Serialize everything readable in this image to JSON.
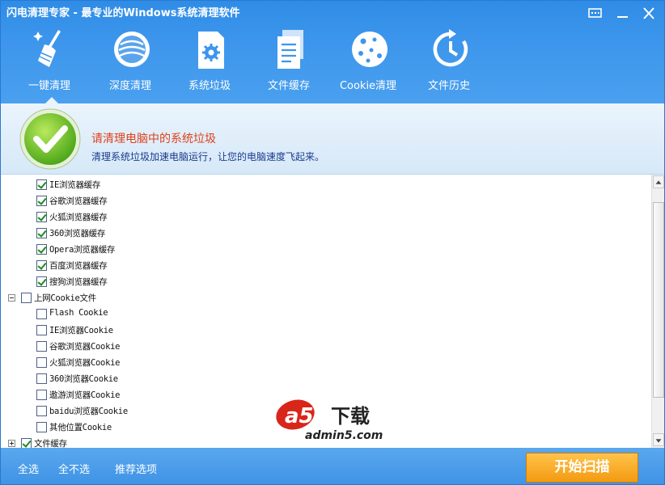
{
  "app": {
    "title": "闪电清理专家 - 最专业的Windows系统清理软件"
  },
  "window_controls": [
    {
      "name": "feedback-icon"
    },
    {
      "name": "minimize-icon"
    },
    {
      "name": "close-icon"
    }
  ],
  "toolbar": {
    "items": [
      {
        "label": "一键清理",
        "icon": "broom-icon",
        "active": true
      },
      {
        "label": "深度清理",
        "icon": "disk-icon",
        "active": false
      },
      {
        "label": "系统垃圾",
        "icon": "gear-document-icon",
        "active": false
      },
      {
        "label": "文件缓存",
        "icon": "file-stack-icon",
        "active": false
      },
      {
        "label": "Cookie清理",
        "icon": "cookie-icon",
        "active": false
      },
      {
        "label": "文件历史",
        "icon": "history-clock-icon",
        "active": false
      }
    ]
  },
  "banner": {
    "title": "请清理电脑中的系统垃圾",
    "subtitle": "清理系统垃圾加速电脑运行，让您的电脑速度飞起来。",
    "title_color": "#e0411b",
    "subtitle_color": "#1a3c8c"
  },
  "tree": {
    "rows": [
      {
        "label": "IE浏览器缓存",
        "checked": true,
        "level": 1
      },
      {
        "label": "谷歌浏览器缓存",
        "checked": true,
        "level": 1
      },
      {
        "label": "火狐浏览器缓存",
        "checked": true,
        "level": 1
      },
      {
        "label": "360浏览器缓存",
        "checked": true,
        "level": 1
      },
      {
        "label": "Opera浏览器缓存",
        "checked": true,
        "level": 1
      },
      {
        "label": "百度浏览器缓存",
        "checked": true,
        "level": 1
      },
      {
        "label": "搜狗浏览器缓存",
        "checked": true,
        "level": 1
      },
      {
        "label": "上网Cookie文件",
        "checked": false,
        "level": 0,
        "expander": "minus"
      },
      {
        "label": "Flash Cookie",
        "checked": false,
        "level": 1
      },
      {
        "label": "IE浏览器Cookie",
        "checked": false,
        "level": 1
      },
      {
        "label": "谷歌浏览器Cookie",
        "checked": false,
        "level": 1
      },
      {
        "label": "火狐浏览器Cookie",
        "checked": false,
        "level": 1
      },
      {
        "label": "360浏览器Cookie",
        "checked": false,
        "level": 1
      },
      {
        "label": "遨游浏览器Cookie",
        "checked": false,
        "level": 1
      },
      {
        "label": "baidu浏览器Cookie",
        "checked": false,
        "level": 1
      },
      {
        "label": "其他位置Cookie",
        "checked": false,
        "level": 1
      },
      {
        "label": "文件缓存",
        "checked": true,
        "level": 0,
        "expander": "plus"
      }
    ]
  },
  "watermark": {
    "brand": "a5下载",
    "url": "admin5.com"
  },
  "footer": {
    "select_all": "全选",
    "select_none": "全不选",
    "recommended": "推荐选项",
    "start_scan": "开始扫描"
  },
  "colors": {
    "header_blue": "#3d96ec",
    "start_button": "#f5a623"
  }
}
